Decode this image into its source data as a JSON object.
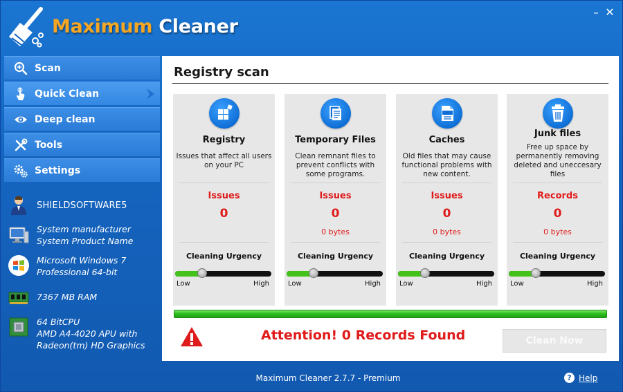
{
  "window": {
    "title_part1": "Maximum",
    "title_part2": "Cleaner",
    "minimize_glyph": "–",
    "close_glyph": "✕"
  },
  "nav": {
    "items": [
      {
        "label": "Scan",
        "icon": "magnifier-icon"
      },
      {
        "label": "Quick Clean",
        "icon": "touch-hand-icon",
        "active": true
      },
      {
        "label": "Deep clean",
        "icon": "eye-icon"
      },
      {
        "label": "Tools",
        "icon": "tools-icon"
      },
      {
        "label": "Settings",
        "icon": "gears-icon"
      }
    ]
  },
  "system": {
    "user": "SHIELDSOFTWARE5",
    "manufacturer": "System manufacturer",
    "product": "System Product Name",
    "os_line1": "Microsoft Windows 7",
    "os_line2": "Professional 64-bit",
    "ram": "7367 MB RAM",
    "cpu_line1": "64 BitCPU",
    "cpu_line2": "AMD A4-4020 APU with",
    "cpu_line3": "Radeon(tm) HD Graphics"
  },
  "main": {
    "title": "Registry scan",
    "cards": [
      {
        "title": "Registry",
        "desc_lines": [
          "Issues that affect all users",
          "on your PC"
        ],
        "metric_label": "Issues",
        "count": "0",
        "size": "",
        "urgency_label": "Cleaning Urgency",
        "low": "Low",
        "high": "High",
        "urgency": 0.28,
        "icon": "registry-blocks-icon"
      },
      {
        "title": "Temporary Files",
        "desc_lines": [
          "Clean remnant files to",
          "prevent conflicts with",
          "some programs."
        ],
        "metric_label": "Issues",
        "count": "0",
        "size": "0 bytes",
        "urgency_label": "Cleaning Urgency",
        "low": "Low",
        "high": "High",
        "urgency": 0.28,
        "icon": "documents-icon"
      },
      {
        "title": "Caches",
        "desc_lines": [
          "Old files that may cause",
          "functional problems with",
          "new content."
        ],
        "metric_label": "Issues",
        "count": "0",
        "size": "0 bytes",
        "urgency_label": "Cleaning Urgency",
        "low": "Low",
        "high": "High",
        "urgency": 0.28,
        "icon": "cache-file-icon"
      },
      {
        "title": "Junk files",
        "desc_lines": [
          "Free up space by",
          "permanently removing",
          "deleted and uneccesary",
          "files"
        ],
        "metric_label": "Records",
        "count": "0",
        "size": "0 bytes",
        "urgency_label": "Cleaning Urgency",
        "low": "Low",
        "high": "High",
        "urgency": 0.28,
        "icon": "trash-bin-icon"
      }
    ],
    "progress": 1.0,
    "alert": "Attention! 0 Records Found",
    "clean_button": "Clean Now"
  },
  "status": {
    "version": "Maximum Cleaner 2.7.7 - Premium",
    "help": "Help",
    "help_glyph": "?"
  },
  "colors": {
    "accent_orange": "#f5a623",
    "window_blue": "#1565c0",
    "alert_red": "#e01b1b",
    "progress_green": "#2cb81e"
  }
}
